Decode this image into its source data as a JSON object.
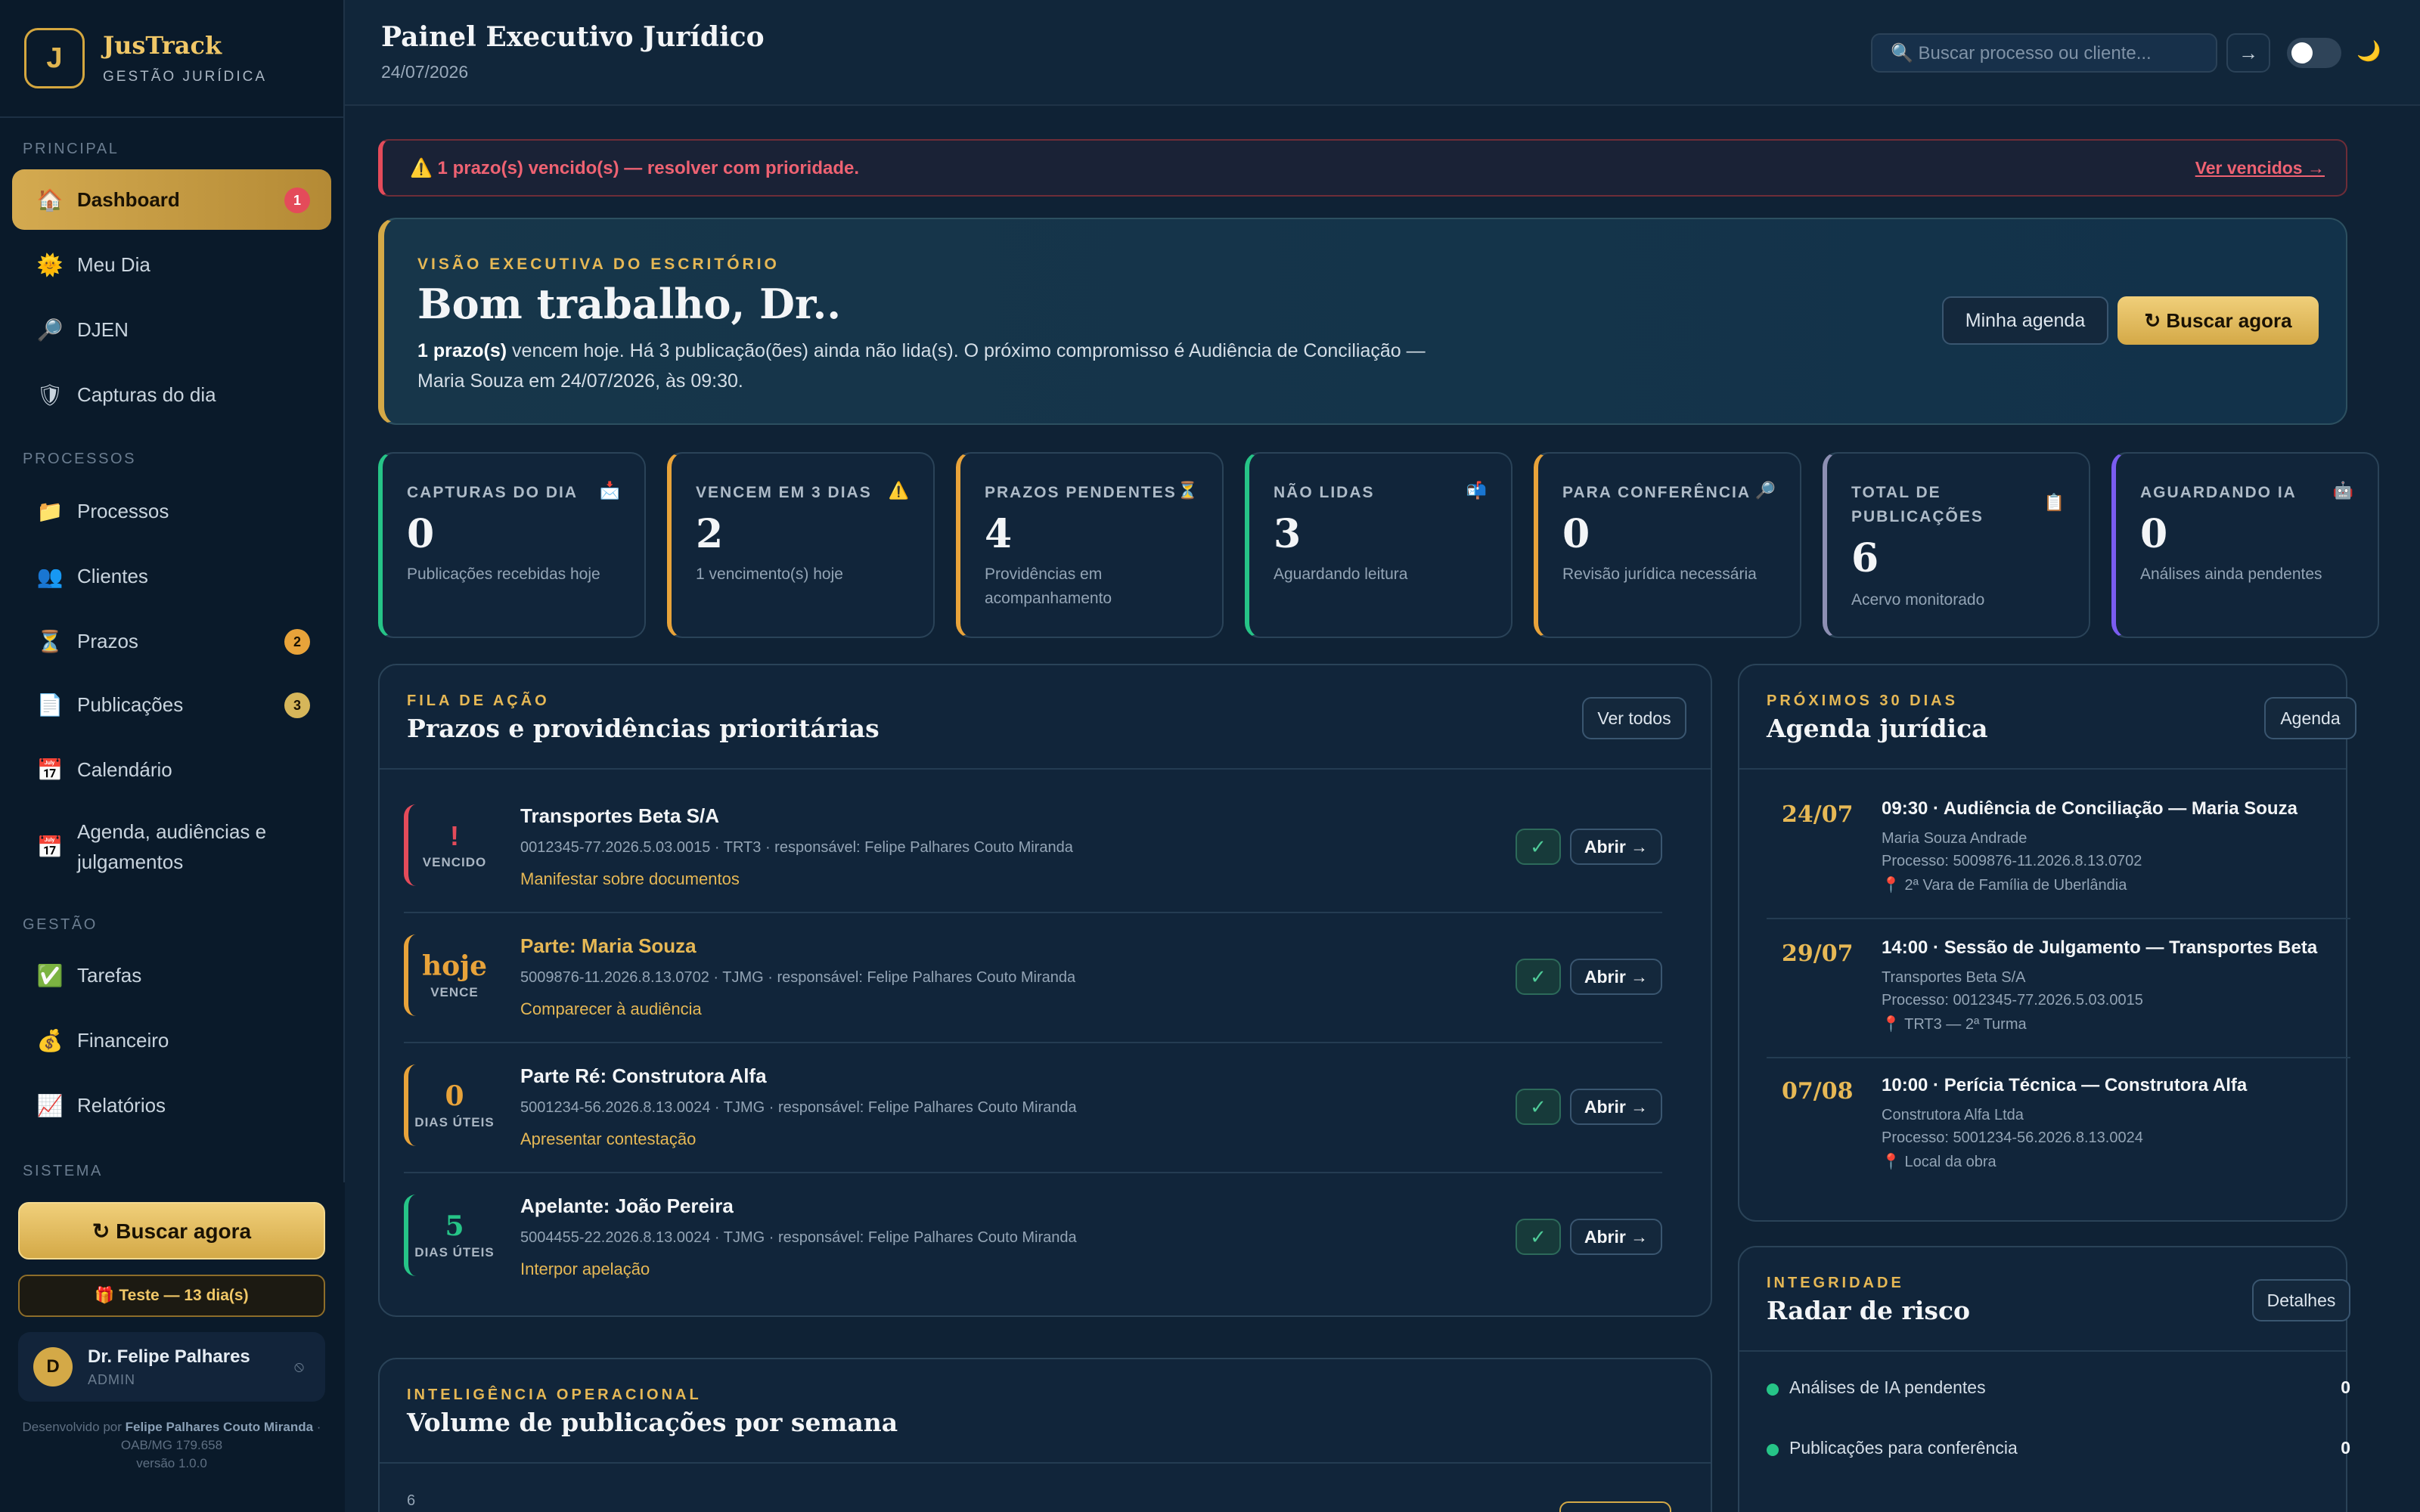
{
  "brand": {
    "name": "JusTrack",
    "subtitle": "GESTÃO JURÍDICA"
  },
  "sidebar": {
    "sections": {
      "principal": "PRINCIPAL",
      "processos": "PROCESSOS",
      "gestao": "GESTÃO",
      "sistema": "SISTEMA"
    },
    "items": [
      {
        "label": "Dashboard",
        "icon": "🏠",
        "badge": "1"
      },
      {
        "label": "Meu Dia",
        "icon": "🌞"
      },
      {
        "label": "DJEN",
        "icon": "🔎"
      },
      {
        "label": "Capturas do dia",
        "icon": "🛡"
      },
      {
        "label": "Processos",
        "icon": "📁"
      },
      {
        "label": "Clientes",
        "icon": "👥"
      },
      {
        "label": "Prazos",
        "icon": "⏳",
        "badge": "2"
      },
      {
        "label": "Publicações",
        "icon": "📄",
        "badge": "3"
      },
      {
        "label": "Calendário",
        "icon": "📅"
      },
      {
        "label": "Agenda, audiências e julgamentos",
        "icon": "📅"
      },
      {
        "label": "Tarefas",
        "icon": "✅"
      },
      {
        "label": "Financeiro",
        "icon": "💰"
      },
      {
        "label": "Relatórios",
        "icon": "📈"
      }
    ],
    "buscar_label": "↻  Buscar agora",
    "trial_label": "🎁 Teste — 13 dia(s)",
    "user": {
      "initial": "D",
      "name": "Dr. Felipe Palhares",
      "role": "ADMIN",
      "action_icon": "⦸"
    },
    "dev": {
      "prefix": "Desenvolvido por ",
      "name": "Felipe Palhares Couto Miranda",
      "oab": " · OAB/MG 179.658",
      "version": "versão 1.0.0"
    }
  },
  "header": {
    "title": "Painel Executivo Jurídico",
    "date": "24/07/2026",
    "search_placeholder": "🔍  Buscar processo ou cliente...",
    "go": "→",
    "theme_icon": "🌙"
  },
  "alert": {
    "text": "⚠️  1 prazo(s) vencido(s) — resolver com prioridade.",
    "link": "Ver vencidos →"
  },
  "hero": {
    "eyebrow": "VISÃO EXECUTIVA DO ESCRITÓRIO",
    "title": "Bom trabalho, Dr..",
    "text_bold": "1 prazo(s)",
    "text_rest": " vencem hoje. Há 3 publicação(ões) ainda não lida(s). O próximo compromisso é Audiência de Conciliação — Maria Souza em 24/07/2026, às 09:30.",
    "btn_agenda": "Minha agenda",
    "btn_buscar": "↻ Buscar agora"
  },
  "kpis": [
    {
      "label": "CAPTURAS DO DIA",
      "icon": "📩",
      "value": "0",
      "sub": "Publicações recebidas hoje",
      "color": "#26c487"
    },
    {
      "label": "VENCEM EM 3 DIAS",
      "icon": "⚠️",
      "value": "2",
      "sub": "1 vencimento(s) hoje",
      "color": "#e8a33a"
    },
    {
      "label": "PRAZOS PENDENTES",
      "icon": "⏳",
      "value": "4",
      "sub": "Providências em acompanhamento",
      "color": "#e8a33a"
    },
    {
      "label": "NÃO LIDAS",
      "icon": "📬",
      "value": "3",
      "sub": "Aguardando leitura",
      "color": "#26c487"
    },
    {
      "label": "PARA CONFERÊNCIA",
      "icon": "🔎",
      "value": "0",
      "sub": "Revisão jurídica necessária",
      "color": "#e8a33a"
    },
    {
      "label": "TOTAL DE PUBLICAÇÕES",
      "icon": "📋",
      "value": "6",
      "sub": "Acervo monitorado",
      "color": "#8d8fb3"
    },
    {
      "label": "AGUARDANDO IA",
      "icon": "🤖",
      "value": "0",
      "sub": "Análises ainda pendentes",
      "color": "#7a5cf0"
    }
  ],
  "tasks_card": {
    "eyebrow": "FILA DE AÇÃO",
    "title": "Prazos e providências prioritárias",
    "btn": "Ver todos",
    "check": "✓",
    "open": "Abrir →",
    "items": [
      {
        "badge_value": "!",
        "badge_unit": "VENCIDO",
        "color": "#e44b5a",
        "name": "Transportes Beta S/A",
        "meta": "0012345-77.2026.5.03.0015 · TRT3 · responsável: Felipe Palhares Couto Miranda",
        "action": "Manifestar sobre documentos"
      },
      {
        "badge_value": "hoje",
        "badge_unit": "VENCE",
        "color": "#e8a33a",
        "name": "Parte: Maria Souza",
        "meta": "5009876-11.2026.8.13.0702 · TJMG · responsável: Felipe Palhares Couto Miranda",
        "action": "Comparecer à audiência"
      },
      {
        "badge_value": "0",
        "badge_unit": "DIAS ÚTEIS",
        "color": "#e8a33a",
        "name": "Parte Ré: Construtora Alfa",
        "meta": "5001234-56.2026.8.13.0024 · TJMG · responsável: Felipe Palhares Couto Miranda",
        "action": "Apresentar contestação"
      },
      {
        "badge_value": "5",
        "badge_unit": "DIAS ÚTEIS",
        "color": "#26c487",
        "name": "Apelante: João Pereira",
        "meta": "5004455-22.2026.8.13.0024 · TJMG · responsável: Felipe Palhares Couto Miranda",
        "action": "Interpor apelação"
      }
    ]
  },
  "agenda_card": {
    "eyebrow": "PRÓXIMOS 30 DIAS",
    "title": "Agenda jurídica",
    "btn": "Agenda",
    "events": [
      {
        "date": "24/07",
        "title": "09:30 · Audiência de Conciliação — Maria Souza",
        "party": "Maria Souza Andrade",
        "process": "Processo: 5009876-11.2026.8.13.0702",
        "place": "📍 2ª Vara de Família de Uberlândia"
      },
      {
        "date": "29/07",
        "title": "14:00 · Sessão de Julgamento — Transportes Beta",
        "party": "Transportes Beta S/A",
        "process": "Processo: 0012345-77.2026.5.03.0015",
        "place": "📍 TRT3 — 2ª Turma"
      },
      {
        "date": "07/08",
        "title": "10:00 · Perícia Técnica — Construtora Alfa",
        "party": "Construtora Alfa Ltda",
        "process": "Processo: 5001234-56.2026.8.13.0024",
        "place": "📍 Local da obra"
      }
    ]
  },
  "chart_card": {
    "eyebrow": "INTELIGÊNCIA OPERACIONAL",
    "title": "Volume de publicações por semana",
    "y_tick": "6"
  },
  "risk_card": {
    "eyebrow": "INTEGRIDADE",
    "title": "Radar de risco",
    "btn": "Detalhes",
    "items": [
      {
        "label": "Análises de IA pendentes",
        "value": "0"
      },
      {
        "label": "Publicações para conferência",
        "value": "0"
      }
    ]
  }
}
